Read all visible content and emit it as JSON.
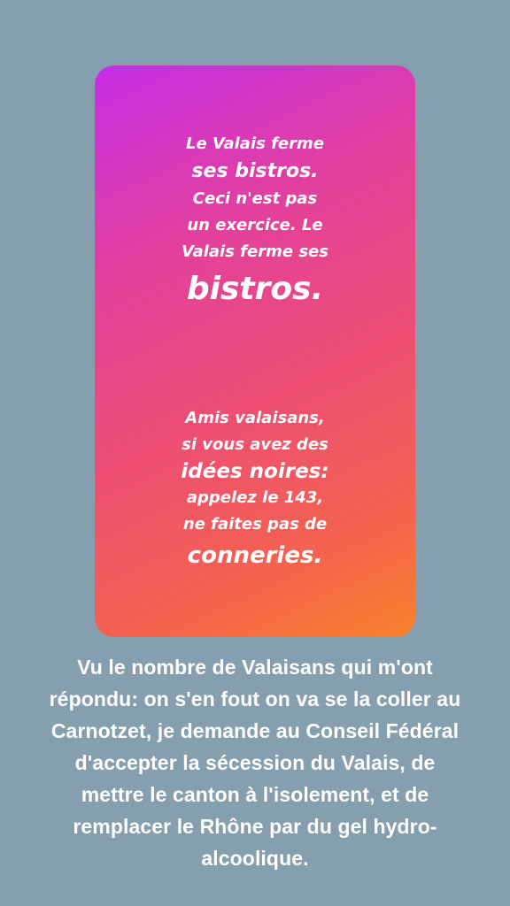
{
  "story": {
    "block1": [
      "Le Valais ferme",
      "ses bistros.",
      "Ceci n'est pas",
      "un exercice. Le",
      "Valais ferme ses",
      "bistros."
    ],
    "block2": [
      "Amis valaisans,",
      "si vous avez des",
      "idées noires:",
      "appelez le 143,",
      "ne faites pas de",
      "conneries."
    ],
    "gradient_colors": [
      "#c72ee6",
      "#e2409e",
      "#ee4f72",
      "#f4634e",
      "#f8822b"
    ]
  },
  "caption": {
    "lines": [
      "Vu le nombre de Valaisans qui m'ont",
      "répondu: on s'en fout on va se la coller au",
      "Carnotzet, je demande au Conseil Fédéral",
      "d'accepter la sécession du Valais, de",
      "mettre le canton à l'isolement, et de",
      "remplacer le Rhône par du gel hydro-",
      "alcoolique."
    ]
  },
  "theme": {
    "background": "#869fae",
    "text_color": "#ffffff"
  }
}
